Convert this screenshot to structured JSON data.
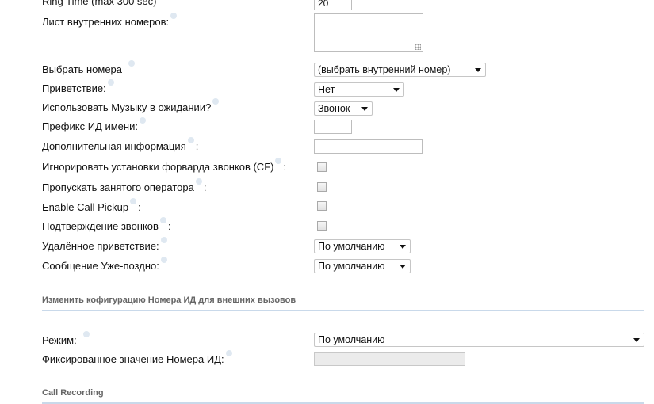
{
  "ring_time": {
    "label": "Ring Time (max 300 sec)",
    "value": "20"
  },
  "extension_list": {
    "label": "Лист внутренних номеров:",
    "value": ""
  },
  "select_numbers": {
    "label": "Выбрать номера",
    "value": "(выбрать внутренний номер)"
  },
  "greeting": {
    "label": "Приветствие:",
    "value": "Нет"
  },
  "music_on_hold": {
    "label": "Использовать Музыку в ожидании?",
    "value": "Звонок"
  },
  "cid_prefix": {
    "label": "Префикс ИД имени:",
    "value": ""
  },
  "extra_info": {
    "label": "Дополнительная информация",
    "suffix": ":",
    "value": ""
  },
  "ignore_cf": {
    "label": "Игнорировать установки форварда звонков (CF)",
    "suffix": ":",
    "checked": false
  },
  "skip_busy": {
    "label": "Пропускать занятого оператора",
    "suffix": ":",
    "checked": false
  },
  "call_pickup": {
    "label": "Enable Call Pickup",
    "suffix": ":",
    "checked": false
  },
  "call_confirm": {
    "label": "Подтверждение звонков",
    "suffix": ":",
    "checked": false
  },
  "remote_greeting": {
    "label": "Удалённое приветствие:",
    "value": "По умолчанию"
  },
  "too_late_msg": {
    "label": "Сообщение Уже-поздно:",
    "value": "По умолчанию"
  },
  "cid_section": {
    "title": "Изменить кофигурацию Номера ИД для внешних вызовов"
  },
  "mode": {
    "label": "Режим:",
    "value": "По умолчанию"
  },
  "fixed_cid": {
    "label": "Фиксированное значение Номера ИД:",
    "value": ""
  },
  "recording_section": {
    "title": "Call Recording"
  }
}
